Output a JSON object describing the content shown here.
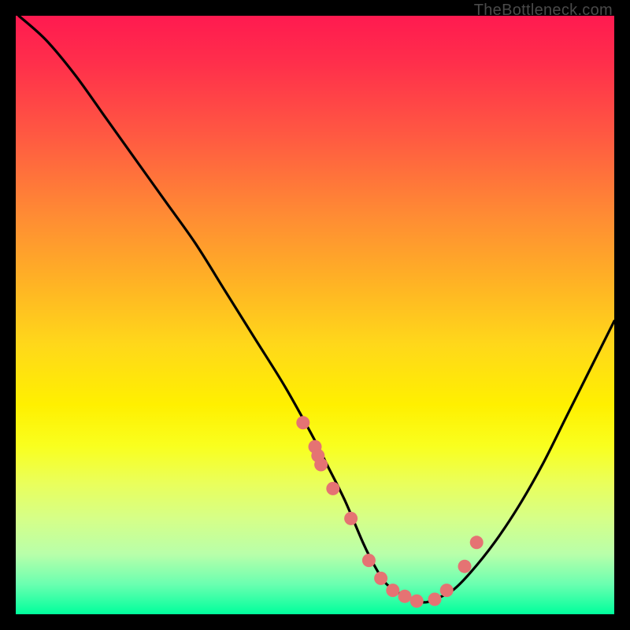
{
  "watermark": "TheBottleneck.com",
  "colors": {
    "curve": "#000000",
    "marker_fill": "#e57373",
    "marker_stroke": "#c75a5a",
    "gradient_top": "#ff1a50",
    "gradient_bottom": "#00ff9c"
  },
  "chart_data": {
    "type": "line",
    "title": "",
    "xlabel": "",
    "ylabel": "",
    "xlim": [
      0,
      100
    ],
    "ylim": [
      0,
      100
    ],
    "grid": false,
    "legend": false,
    "series": [
      {
        "name": "bottleneck-curve",
        "x": [
          0.5,
          5,
          10,
          15,
          20,
          25,
          30,
          35,
          40,
          45,
          50,
          52,
          55,
          58,
          60,
          62,
          65,
          68,
          70,
          73,
          76,
          80,
          84,
          88,
          92,
          96,
          100
        ],
        "values": [
          100,
          96,
          90,
          83,
          76,
          69,
          62,
          54,
          46,
          38,
          29,
          25,
          19,
          12,
          8,
          5,
          3,
          2,
          2.5,
          4,
          7,
          12,
          18,
          25,
          33,
          41,
          49
        ]
      }
    ],
    "markers": {
      "name": "highlighted-points",
      "x": [
        48,
        50,
        50.5,
        51,
        53,
        56,
        59,
        61,
        63,
        65,
        67,
        70,
        72,
        75,
        77
      ],
      "values": [
        32,
        28,
        26.5,
        25,
        21,
        16,
        9,
        6,
        4,
        3,
        2.2,
        2.5,
        4,
        8,
        12
      ]
    }
  }
}
